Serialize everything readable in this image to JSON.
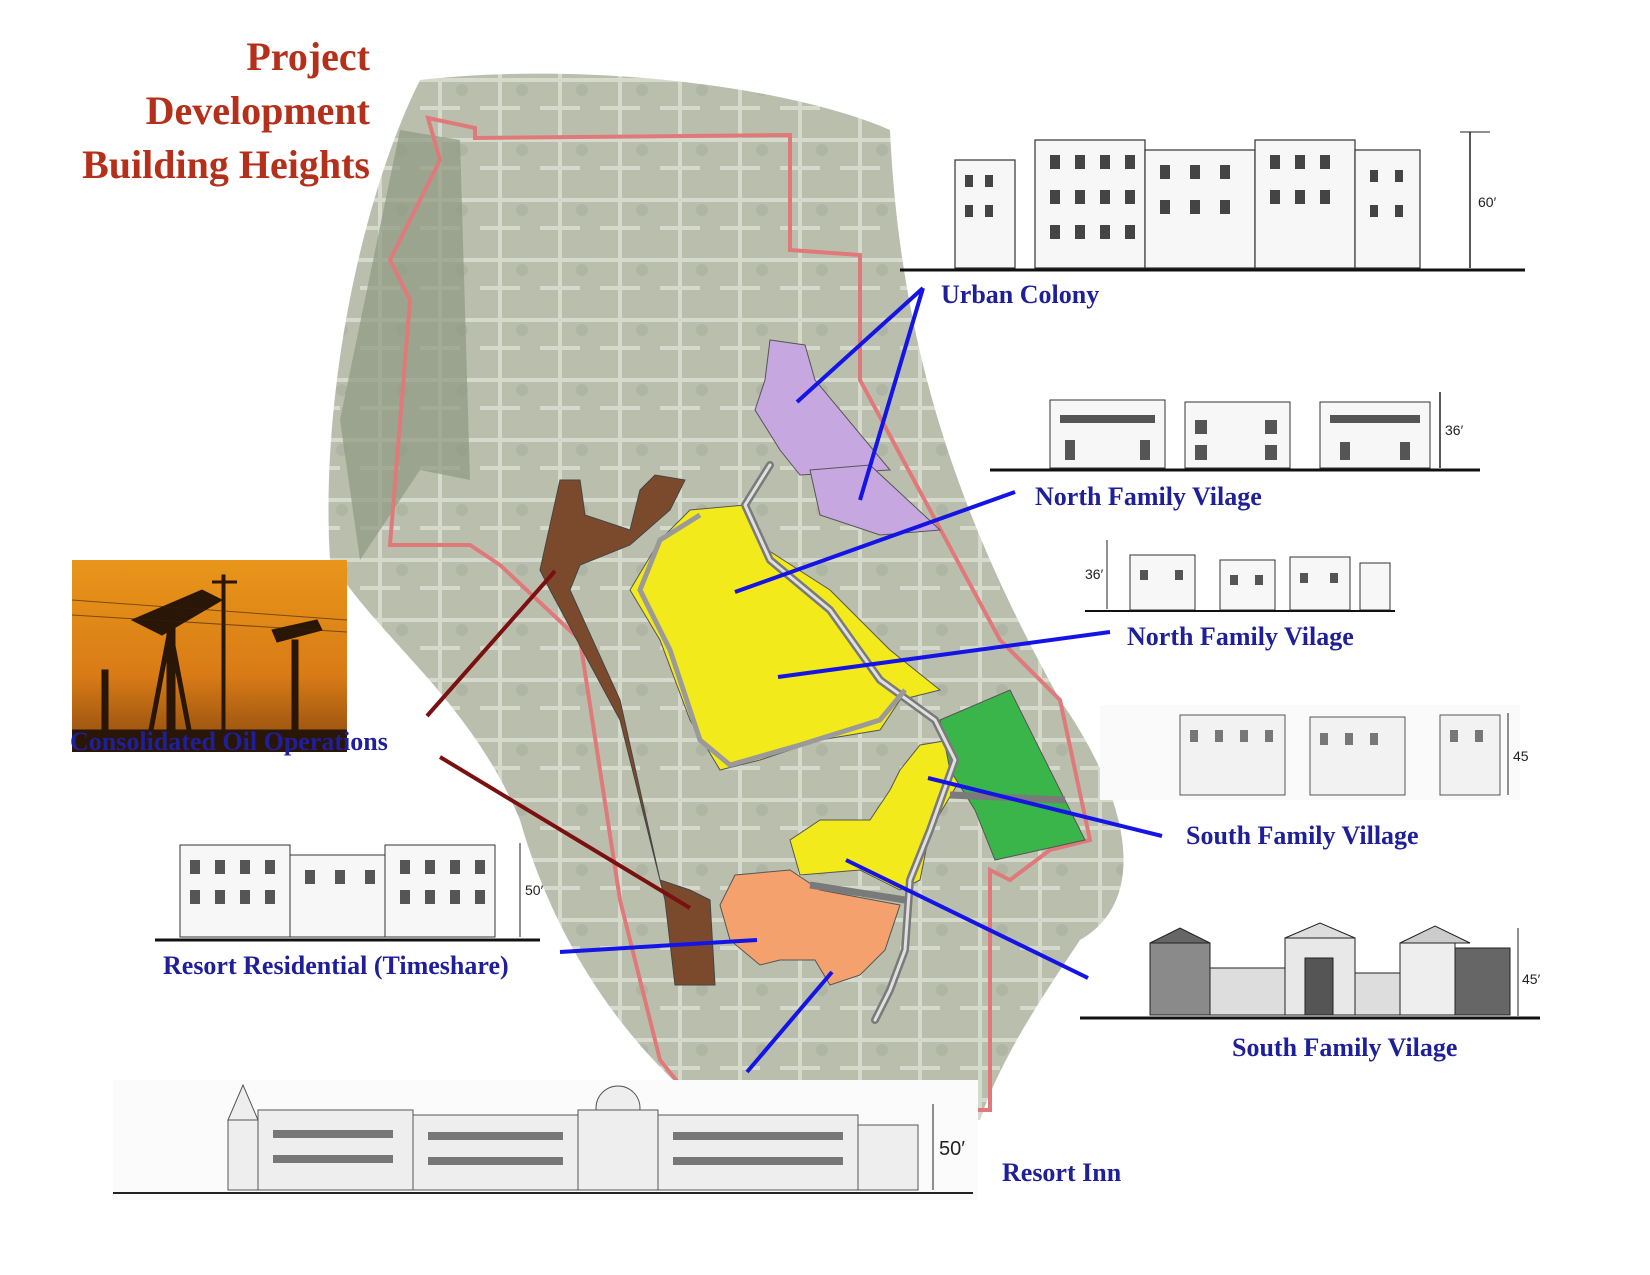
{
  "title": {
    "line1": "Project",
    "line2": "Development",
    "line3": "Building Heights"
  },
  "labels": {
    "urban_colony": "Urban Colony",
    "north_family_1": "North Family Vilage",
    "north_family_2": "North Family Vilage",
    "south_family_1": "South Family Village",
    "south_family_2": "South Family Vilage",
    "consolidated_oil": "Consolidated Oil Operations",
    "resort_residential": "Resort Residential (Timeshare)",
    "resort_inn": "Resort Inn"
  },
  "heights": {
    "urban_colony": "60′",
    "north_family_1": "36′",
    "north_family_2": "36′",
    "south_family_1": "45",
    "south_family_2": "45′",
    "resort_residential": "50′",
    "resort_inn": "50′"
  },
  "zone_colors": {
    "urban_colony": "#c7a7df",
    "family_village": "#f2ea1a",
    "south_green": "#3ab54a",
    "resort": "#f4a16d",
    "oil": "#7b4a2c",
    "roads": "#8a8a8a",
    "site_boundary": "#e07a7a",
    "leader_blue": "#1414e6",
    "leader_oil": "#7a1010"
  }
}
